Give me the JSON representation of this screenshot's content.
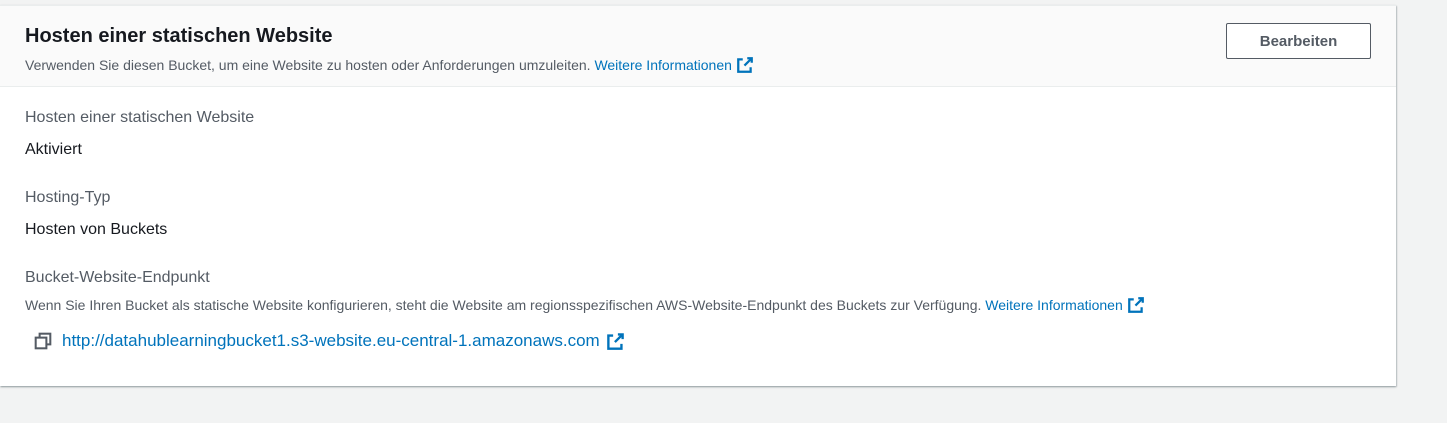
{
  "panel": {
    "title": "Hosten einer statischen Website",
    "description": "Verwenden Sie diesen Bucket, um eine Website zu hosten oder Anforderungen umzuleiten.",
    "more_info_label": "Weitere Informationen",
    "edit_button_label": "Bearbeiten"
  },
  "fields": {
    "static_hosting": {
      "label": "Hosten einer statischen Website",
      "value": "Aktiviert"
    },
    "hosting_type": {
      "label": "Hosting-Typ",
      "value": "Hosten von Buckets"
    },
    "endpoint": {
      "label": "Bucket-Website-Endpunkt",
      "description": "Wenn Sie Ihren Bucket als statische Website konfigurieren, steht die Website am regionsspezifischen AWS-Website-Endpunkt des Buckets zur Verfügung.",
      "more_info_label": "Weitere Informationen",
      "url": "http://datahublearningbucket1.s3-website.eu-central-1.amazonaws.com"
    }
  },
  "icons": {
    "external_link": "external-link-icon",
    "copy": "copy-icon"
  },
  "colors": {
    "link": "#0073bb",
    "text": "#16191f",
    "secondary_text": "#545b64",
    "page_background": "#f2f3f3",
    "header_background": "#fafafa"
  }
}
